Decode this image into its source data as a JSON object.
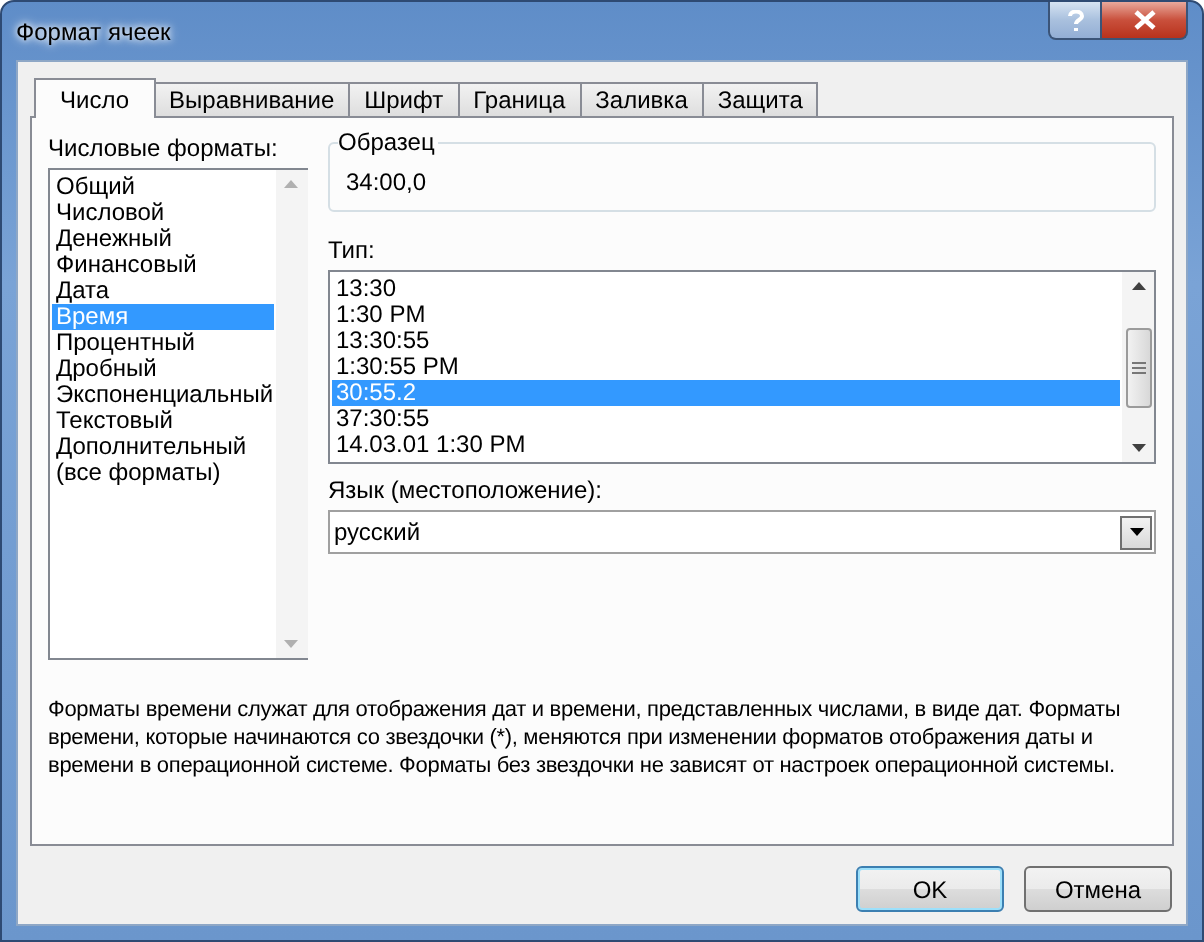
{
  "window": {
    "title": "Формат ячеек"
  },
  "tabs": [
    {
      "label": "Число",
      "selected": true
    },
    {
      "label": "Выравнивание",
      "selected": false
    },
    {
      "label": "Шрифт",
      "selected": false
    },
    {
      "label": "Граница",
      "selected": false
    },
    {
      "label": "Заливка",
      "selected": false
    },
    {
      "label": "Защита",
      "selected": false
    }
  ],
  "categories": {
    "label": "Числовые форматы:",
    "items": [
      {
        "label": "Общий",
        "selected": false
      },
      {
        "label": "Числовой",
        "selected": false
      },
      {
        "label": "Денежный",
        "selected": false
      },
      {
        "label": "Финансовый",
        "selected": false
      },
      {
        "label": "Дата",
        "selected": false
      },
      {
        "label": "Время",
        "selected": true
      },
      {
        "label": "Процентный",
        "selected": false
      },
      {
        "label": "Дробный",
        "selected": false
      },
      {
        "label": "Экспоненциальный",
        "selected": false
      },
      {
        "label": "Текстовый",
        "selected": false
      },
      {
        "label": "Дополнительный",
        "selected": false
      },
      {
        "label": "(все форматы)",
        "selected": false
      }
    ]
  },
  "sample": {
    "label": "Образец",
    "value": "34:00,0"
  },
  "type": {
    "label": "Тип:",
    "items": [
      {
        "label": "13:30",
        "selected": false
      },
      {
        "label": "1:30 PM",
        "selected": false
      },
      {
        "label": "13:30:55",
        "selected": false
      },
      {
        "label": "1:30:55 PM",
        "selected": false
      },
      {
        "label": "30:55.2",
        "selected": true
      },
      {
        "label": "37:30:55",
        "selected": false
      },
      {
        "label": "14.03.01 1:30 PM",
        "selected": false
      }
    ]
  },
  "locale": {
    "label": "Язык (местоположение):",
    "value": "русский"
  },
  "description": "Форматы времени служат для отображения дат и времени, представленных числами, в виде дат. Форматы времени, которые начинаются со звездочки (*), меняются при изменении форматов отображения даты и времени в операционной системе. Форматы без звездочки не зависят от настроек операционной системы.",
  "buttons": [
    {
      "label": "OK",
      "default": true
    },
    {
      "label": "Отмена",
      "default": false
    }
  ]
}
